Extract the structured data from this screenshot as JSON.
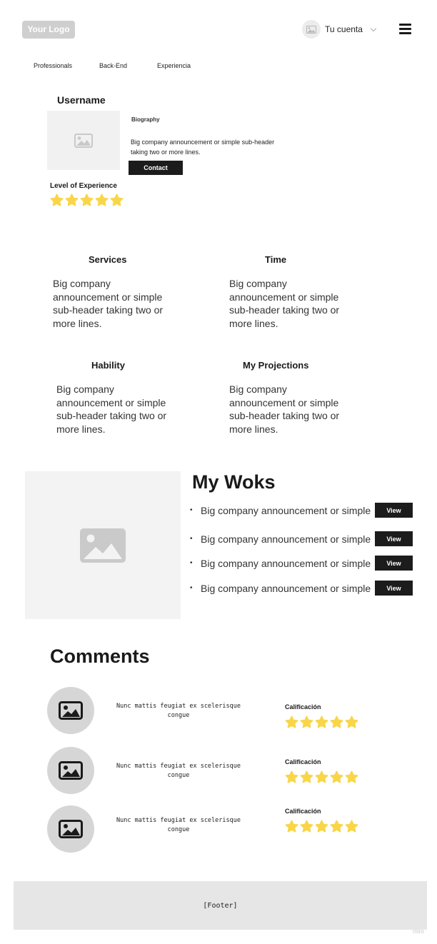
{
  "header": {
    "logo": "Your Logo",
    "account_label": "Tu cuenta"
  },
  "nav": [
    "Professionals",
    "Back-End",
    "Experiencia"
  ],
  "profile": {
    "username": "Username",
    "bio_title": "Biography",
    "bio_text": "Big company announcement or simple sub-header taking two or more lines.",
    "contact_label": "Contact",
    "level_label": "Level of Experience",
    "level_rating": 5
  },
  "sections": [
    {
      "title": "Services",
      "body": "Big company announcement or simple sub-header taking two or more lines."
    },
    {
      "title": "Time",
      "body": "Big company announcement or simple sub-header taking two or more lines."
    },
    {
      "title": "Hability",
      "body": "Big company announcement or simple sub-header taking two or more lines."
    },
    {
      "title": "My Projections",
      "body": "Big company announcement or simple sub-header taking two or more lines."
    }
  ],
  "works": {
    "title": "My Woks",
    "items": [
      {
        "text": "Big company announcement or simple",
        "button": "View"
      },
      {
        "text": "Big company announcement or simple",
        "button": "View"
      },
      {
        "text": "Big company announcement or simple",
        "button": "View"
      },
      {
        "text": "Big company announcement or simple",
        "button": "View"
      }
    ]
  },
  "comments": {
    "title": "Comments",
    "items": [
      {
        "text": "Nunc mattis feugiat ex scelerisque congue",
        "rating_label": "Calificación",
        "rating": 5
      },
      {
        "text": "Nunc mattis feugiat ex scelerisque congue",
        "rating_label": "Calificación",
        "rating": 5
      },
      {
        "text": "Nunc mattis feugiat ex scelerisque congue",
        "rating_label": "Calificación",
        "rating": 5
      }
    ]
  },
  "footer": "[Footer]",
  "watermark": "miro",
  "colors": {
    "star": "#F9D649",
    "button": "#1C1C1C",
    "placeholder_bg": "#F3F3F3",
    "footer_bg": "#E6E6E6"
  }
}
